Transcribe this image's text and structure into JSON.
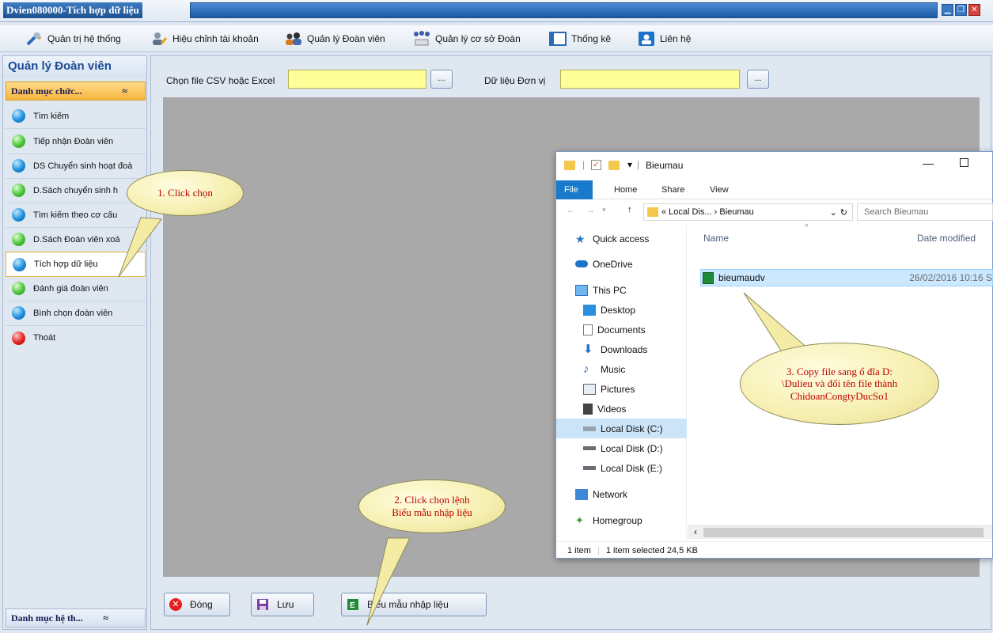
{
  "window": {
    "title": "Dvien080000-Tích hợp dữ liệu"
  },
  "menubar": {
    "items": [
      {
        "label": "Quản trị hệ thống",
        "icon": "tools-icon"
      },
      {
        "label": "Hiệu chỉnh tài khoản",
        "icon": "user-edit-icon"
      },
      {
        "label": "Quản lý Đoàn viên",
        "icon": "users-icon"
      },
      {
        "label": "Quản lý cơ sở Đoàn",
        "icon": "network-icon"
      },
      {
        "label": "Thống kê",
        "icon": "report-icon"
      },
      {
        "label": "Liên hệ",
        "icon": "contact-icon"
      }
    ]
  },
  "sidebar": {
    "title": "Quản lý Đoàn viên",
    "category": "Danh mục chức...",
    "bottom_category": "Danh mục hệ th...",
    "items": [
      {
        "label": "Tìm kiếm",
        "color": "blue"
      },
      {
        "label": "Tiếp nhận Đoàn viên",
        "color": "green"
      },
      {
        "label": "DS Chuyển sinh hoạt đoà",
        "color": "blue"
      },
      {
        "label": "D.Sách chuyển sinh h",
        "color": "green"
      },
      {
        "label": "Tìm kiếm theo cơ cấu",
        "color": "blue"
      },
      {
        "label": "D.Sách Đoàn viên xoá",
        "color": "green"
      },
      {
        "label": "Tích hợp dữ liệu",
        "color": "blue"
      },
      {
        "label": "Đánh giá đoàn viên",
        "color": "green"
      },
      {
        "label": "Bình chọn đoàn viên",
        "color": "blue"
      },
      {
        "label": "Thoát",
        "color": "red"
      }
    ]
  },
  "form": {
    "file_label": "Chọn file CSV hoặc Excel",
    "file_value": "",
    "unit_label": "Dữ liệu Đơn vị",
    "unit_value": "",
    "browse_label": "..."
  },
  "buttons": {
    "close": "Đóng",
    "save": "Lưu",
    "template": "Biểu mẫu nhập liệu"
  },
  "explorer": {
    "title": "Bieumau",
    "tabs": [
      "File",
      "Home",
      "Share",
      "View"
    ],
    "breadcrumb": "« Local Dis... › Bieumau",
    "search_placeholder": "Search Bieumau",
    "nav": [
      "Quick access",
      "OneDrive",
      "This PC",
      "Desktop",
      "Documents",
      "Downloads",
      "Music",
      "Pictures",
      "Videos",
      "Local Disk (C:)",
      "Local Disk (D:)",
      "Local Disk (E:)",
      "Network",
      "Homegroup"
    ],
    "columns": {
      "name": "Name",
      "date": "Date modified"
    },
    "files": [
      {
        "name": "bieumaudv",
        "date": "26/02/2016 10:16 S"
      }
    ],
    "status": {
      "count": "1 item",
      "selected": "1 item selected  24,5 KB"
    }
  },
  "callouts": {
    "one": "1. Click chọn",
    "two_a": "2. Click chọn lệnh",
    "two_b": "Biểu mẫu nhập liệu",
    "three_a": "3. Copy file sang ổ đĩa D:",
    "three_b": "\\Dulieu và đổi tên file thành",
    "three_c": "ChidoanCongtyDucSo1"
  }
}
